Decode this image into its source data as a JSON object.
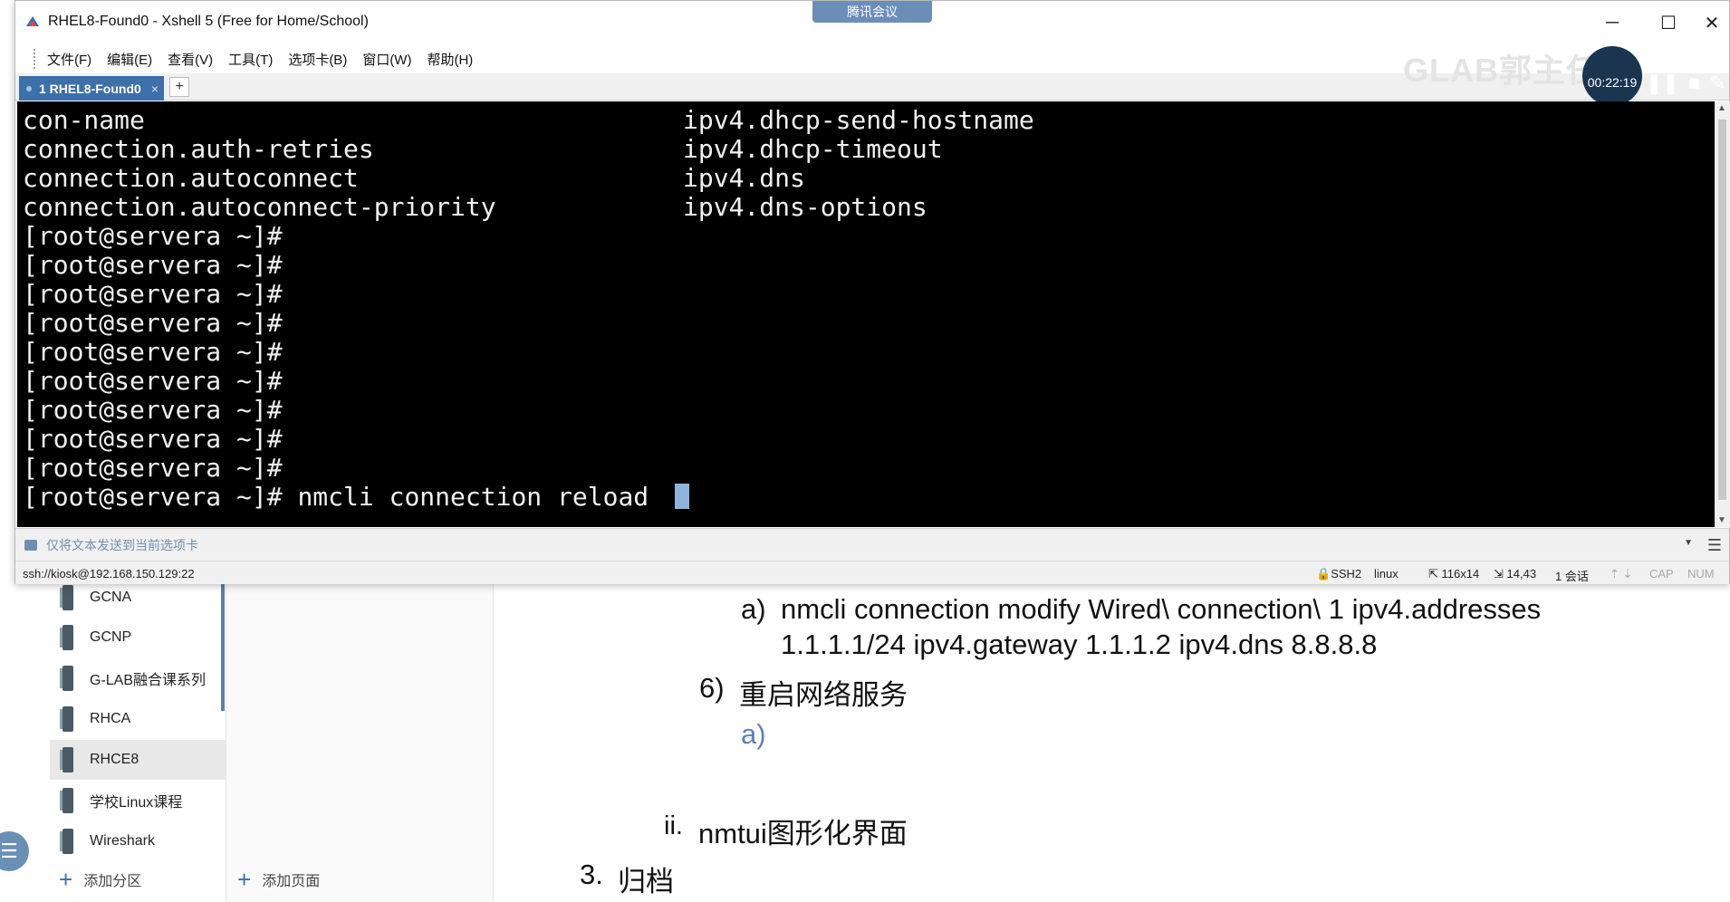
{
  "window": {
    "title": "RHEL8-Found0 - Xshell 5 (Free for Home/School)",
    "meeting_badge": "腾讯会议",
    "controls": {
      "minimize": "─",
      "maximize": "☐",
      "close": "✕"
    }
  },
  "menubar": {
    "items": [
      "文件(F)",
      "编辑(E)",
      "查看(V)",
      "工具(T)",
      "选项卡(B)",
      "窗口(W)",
      "帮助(H)"
    ]
  },
  "tabs": {
    "active_label": "1 RHEL8-Found0",
    "close_glyph": "×",
    "add_glyph": "+"
  },
  "overlay": {
    "watermark": "GLAB郭主任",
    "recording_time": "00:22:19"
  },
  "terminal": {
    "lines": [
      {
        "left": "con-name",
        "right": "ipv4.dhcp-send-hostname"
      },
      {
        "left": "connection.auth-retries",
        "right": "ipv4.dhcp-timeout"
      },
      {
        "left": "connection.autoconnect",
        "right": "ipv4.dns"
      },
      {
        "left": "connection.autoconnect-priority",
        "right": "ipv4.dns-options"
      },
      {
        "left": "[root@servera ~]#",
        "right": ""
      },
      {
        "left": "[root@servera ~]#",
        "right": ""
      },
      {
        "left": "[root@servera ~]#",
        "right": ""
      },
      {
        "left": "[root@servera ~]#",
        "right": ""
      },
      {
        "left": "[root@servera ~]#",
        "right": ""
      },
      {
        "left": "[root@servera ~]#",
        "right": ""
      },
      {
        "left": "[root@servera ~]#",
        "right": ""
      },
      {
        "left": "[root@servera ~]#",
        "right": ""
      },
      {
        "left": "[root@servera ~]#",
        "right": ""
      }
    ],
    "prompt": "[root@servera ~]# ",
    "command": "nmcli connection reload "
  },
  "compose_bar": {
    "text": "仅将文本发送到当前选项卡"
  },
  "statusbar": {
    "connection": "ssh://kiosk@192.168.150.129:22",
    "protocol": "SSH2",
    "terminal_type": "linux",
    "size": "116x14",
    "cursor_pos": "14,43",
    "sessions": "1 会话",
    "cap": "CAP",
    "num": "NUM"
  },
  "notebook": {
    "sections": [
      "GCNA",
      "GCNP",
      "G-LAB融合课系列",
      "RHCA",
      "RHCE8",
      "学校Linux课程",
      "Wireshark"
    ],
    "active_section": "RHCE8",
    "add_section": "添加分区",
    "add_page": "添加页面"
  },
  "note": {
    "item_a_marker": "a)",
    "item_a_line1": "nmcli connection modify Wired\\ connection\\ 1 ipv4.addresses",
    "item_a_line2": "1.1.1.1/24 ipv4.gateway 1.1.1.2 ipv4.dns 8.8.8.8",
    "item6_marker": "6)",
    "item6_text": "重启网络服务",
    "item6a_marker": "a)",
    "item_ii_marker": "ii.",
    "item_ii_text": "nmtui图形化界面",
    "item3_marker": "3.",
    "item3_text": "归档"
  }
}
